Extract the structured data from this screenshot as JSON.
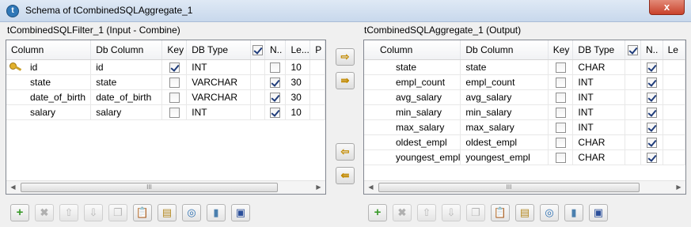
{
  "window": {
    "title": "Schema of tCombinedSQLAggregate_1",
    "close_label": "x"
  },
  "input_panel": {
    "label": "tCombinedSQLFilter_1 (Input - Combine)",
    "headers": [
      "Column",
      "Db Column",
      "Key",
      "DB Type",
      "",
      "N..",
      "Le...",
      "P"
    ],
    "rows": [
      {
        "column": "id",
        "db_column": "id",
        "key": true,
        "db_type": "INT",
        "nullable": false,
        "length": "10"
      },
      {
        "column": "state",
        "db_column": "state",
        "key": false,
        "db_type": "VARCHAR",
        "nullable": true,
        "length": "30"
      },
      {
        "column": "date_of_birth",
        "db_column": "date_of_birth",
        "key": false,
        "db_type": "VARCHAR",
        "nullable": true,
        "length": "30"
      },
      {
        "column": "salary",
        "db_column": "salary",
        "key": false,
        "db_type": "INT",
        "nullable": true,
        "length": "10"
      }
    ]
  },
  "output_panel": {
    "label": "tCombinedSQLAggregate_1 (Output)",
    "headers": [
      "Column",
      "Db Column",
      "Key",
      "DB Type",
      "",
      "N..",
      "Le"
    ],
    "rows": [
      {
        "column": "state",
        "db_column": "state",
        "key": false,
        "db_type": "CHAR",
        "nullable": true
      },
      {
        "column": "empl_count",
        "db_column": "empl_count",
        "key": false,
        "db_type": "INT",
        "nullable": true
      },
      {
        "column": "avg_salary",
        "db_column": "avg_salary",
        "key": false,
        "db_type": "INT",
        "nullable": true
      },
      {
        "column": "min_salary",
        "db_column": "min_salary",
        "key": false,
        "db_type": "INT",
        "nullable": true
      },
      {
        "column": "max_salary",
        "db_column": "max_salary",
        "key": false,
        "db_type": "INT",
        "nullable": true
      },
      {
        "column": "oldest_empl",
        "db_column": "oldest_empl",
        "key": false,
        "db_type": "CHAR",
        "nullable": true
      },
      {
        "column": "youngest_empl",
        "db_column": "youngest_empl",
        "key": false,
        "db_type": "CHAR",
        "nullable": true
      }
    ]
  },
  "scroll_thumb_label": "III",
  "icons": {
    "copy_selected": "arrow-right-icon",
    "copy_all": "double-arrow-right-icon",
    "copy_back_selected": "arrow-left-icon",
    "copy_back_all": "double-arrow-left-icon",
    "add": "plus-icon",
    "remove": "x-icon",
    "move_up": "arrow-up-icon",
    "move_down": "arrow-down-icon",
    "copy": "copy-icon",
    "paste": "paste-icon",
    "import": "import-icon",
    "export": "export-icon",
    "reset": "reset-icon",
    "save": "save-icon"
  },
  "colors": {
    "accent_arrow": "#c28a00",
    "add_green": "#3a9a2b",
    "close_red": "#c9422b"
  }
}
